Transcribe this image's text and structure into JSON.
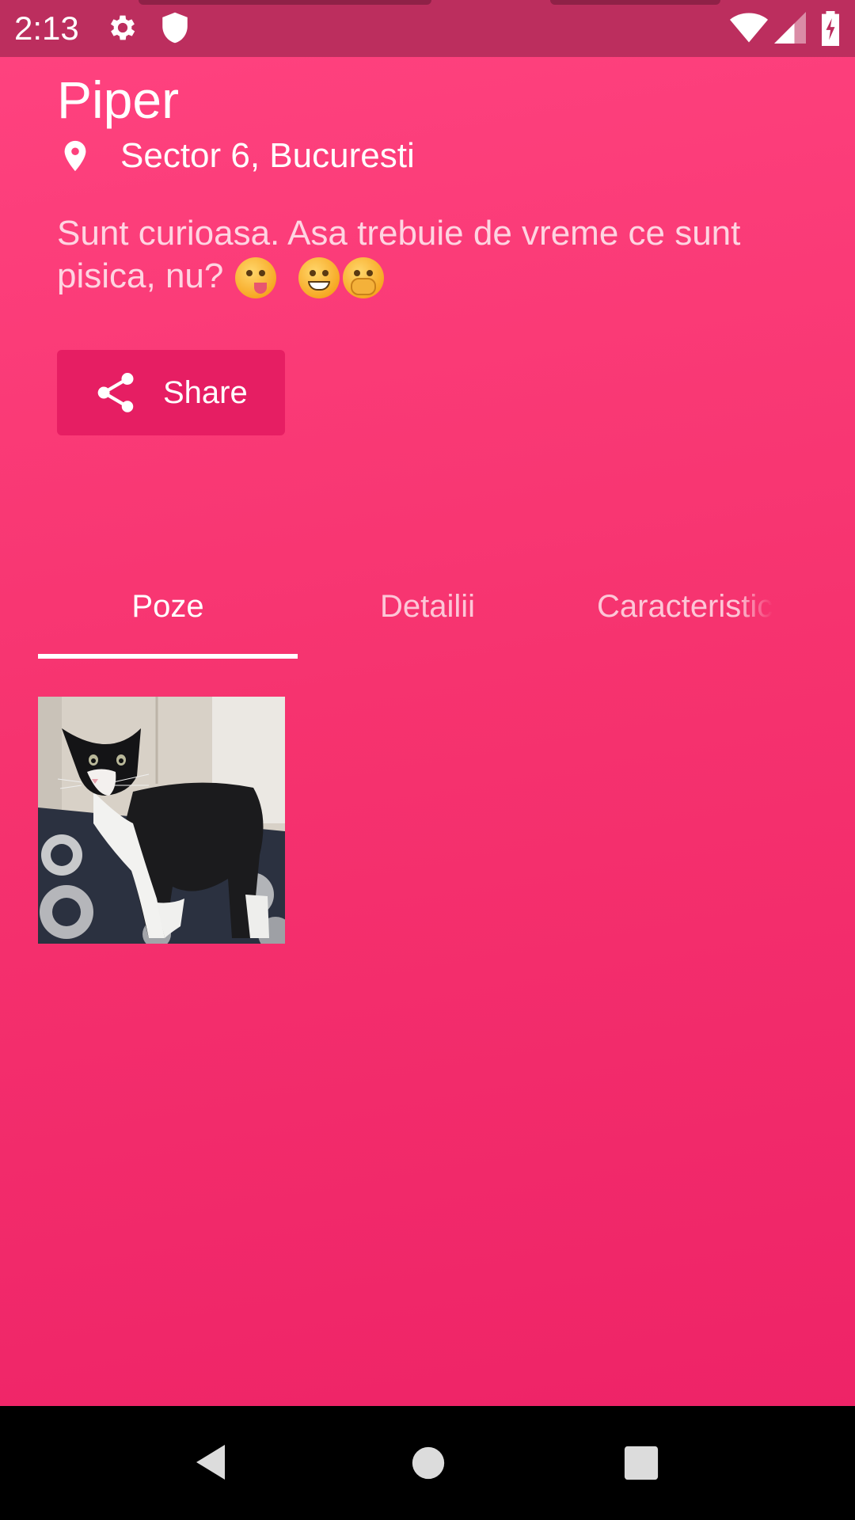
{
  "status_bar": {
    "time": "2:13",
    "icons": [
      "gear-icon",
      "shield-icon",
      "wifi-icon",
      "signal-icon",
      "battery-charging-icon"
    ]
  },
  "profile": {
    "name": "Piper",
    "location": "Sector 6, Bucuresti",
    "description": "Sunt curioasa. Asa trebuie de vreme ce sunt pisica, nu?",
    "description_emojis": [
      "face-savoring-food",
      "grinning-face-with-smiling-eyes",
      "face-with-hand-over-mouth"
    ]
  },
  "actions": {
    "share_label": "Share"
  },
  "tabs": [
    {
      "label": "Poze",
      "active": true
    },
    {
      "label": "Detailii",
      "active": false
    },
    {
      "label": "Caracteristic",
      "active": false
    }
  ],
  "photos": [
    {
      "subject": "black-and-white-cat"
    }
  ],
  "nav_bar": {
    "buttons": [
      "back-icon",
      "home-icon",
      "recents-icon"
    ]
  },
  "colors": {
    "background_top": "#ff4380",
    "background_bottom": "#ed2166",
    "status_bar": "#bc2e5e",
    "share_button": "#e61e63",
    "nav_bar": "#000000"
  }
}
